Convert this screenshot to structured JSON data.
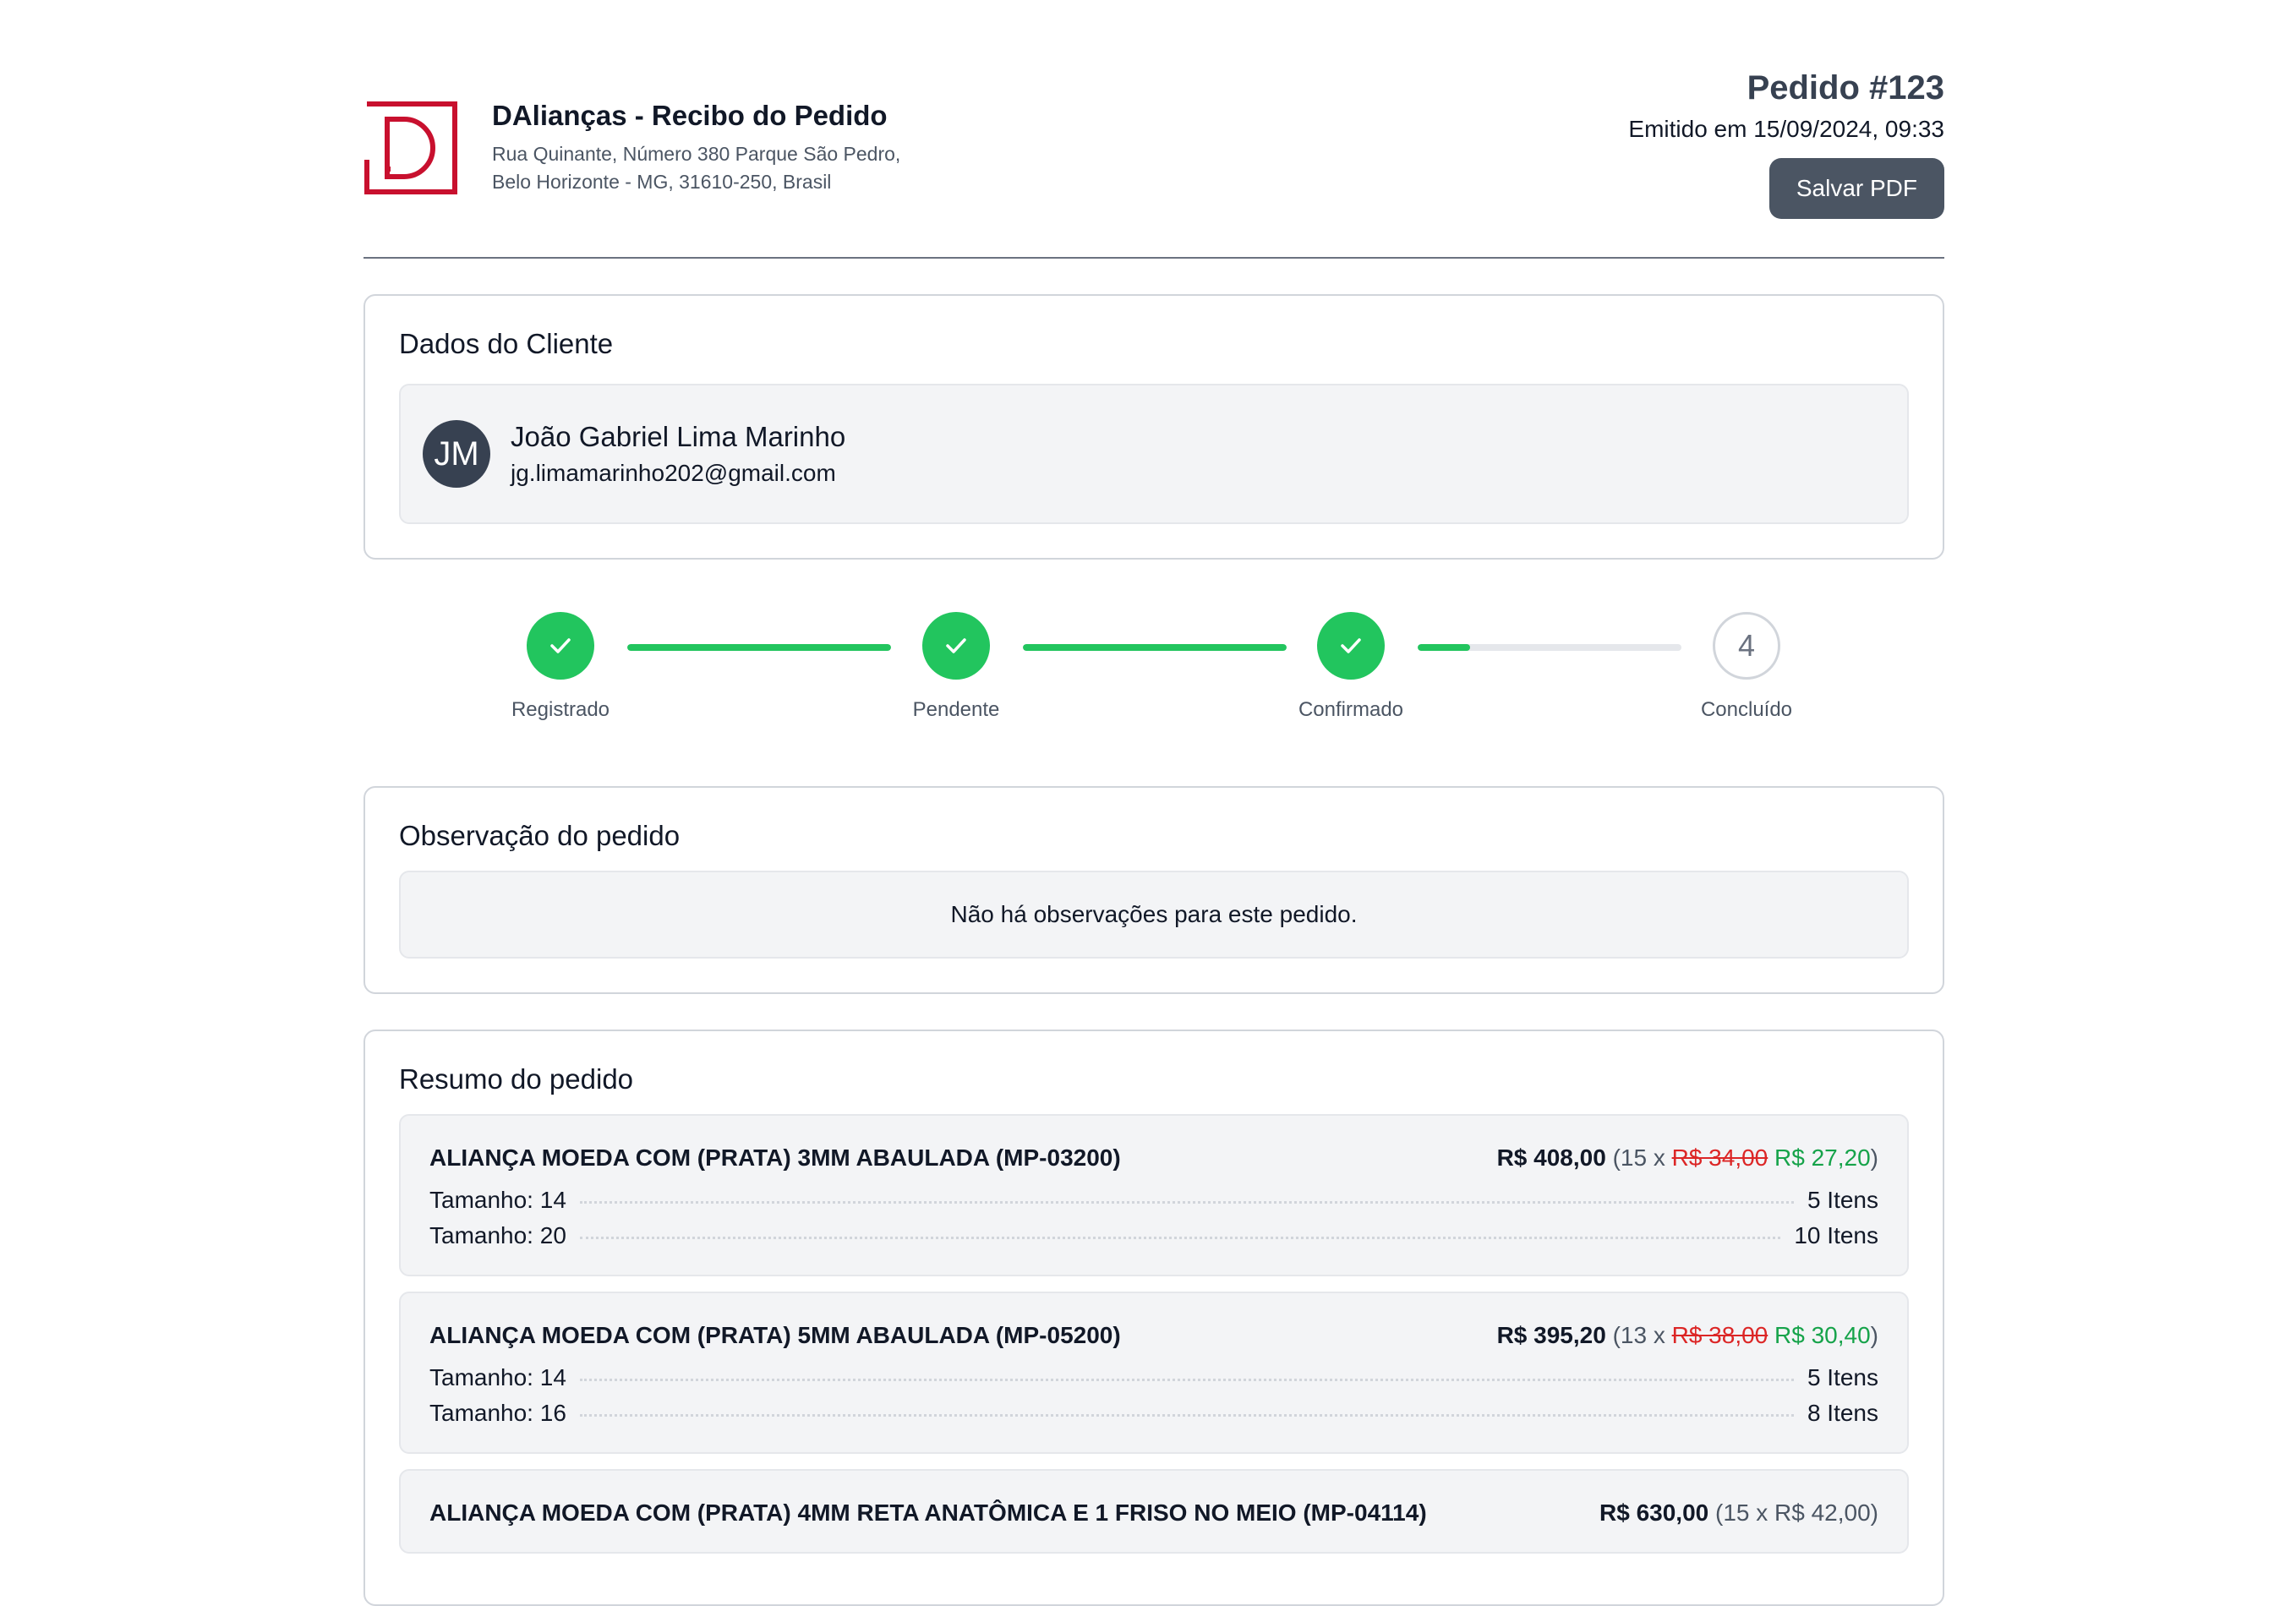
{
  "header": {
    "brand_title": "DAlianças - Recibo do Pedido",
    "address_line1": "Rua Quinante, Número 380 Parque São Pedro,",
    "address_line2": "Belo Horizonte - MG, 31610-250, Brasil",
    "order_number": "Pedido #123",
    "issued": "Emitido em 15/09/2024, 09:33",
    "save_pdf_label": "Salvar PDF",
    "logo_icon": "d-logo-icon",
    "brand_color": "#c8102e"
  },
  "client": {
    "title": "Dados do Cliente",
    "initials": "JM",
    "name": "João Gabriel Lima Marinho",
    "email": "jg.limamarinho202@gmail.com"
  },
  "progress": {
    "steps": [
      {
        "label": "Registrado",
        "status": "done",
        "icon": "check-icon"
      },
      {
        "label": "Pendente",
        "status": "done",
        "icon": "check-icon"
      },
      {
        "label": "Confirmado",
        "status": "done",
        "icon": "check-icon"
      },
      {
        "label": "Concluído",
        "status": "todo",
        "number": "4"
      }
    ],
    "bar_fill_percent": [
      100,
      100,
      20
    ],
    "accent_color": "#22c55e"
  },
  "observation": {
    "title": "Observação do pedido",
    "text": "Não há observações para este pedido."
  },
  "summary": {
    "title": "Resumo do pedido",
    "items": [
      {
        "name": "ALIANÇA MOEDA COM (PRATA) 3MM ABAULADA (MP-03200)",
        "total": "R$ 408,00",
        "qty_prefix": "(15 x ",
        "old_price": "R$ 34,00",
        "new_price": "R$ 27,20",
        "suffix": ")",
        "sizes": [
          {
            "label": "Tamanho: 14",
            "qty": "5 Itens"
          },
          {
            "label": "Tamanho: 20",
            "qty": "10 Itens"
          }
        ]
      },
      {
        "name": "ALIANÇA MOEDA COM (PRATA) 5MM ABAULADA (MP-05200)",
        "total": "R$ 395,20",
        "qty_prefix": "(13 x ",
        "old_price": "R$ 38,00",
        "new_price": "R$ 30,40",
        "suffix": ")",
        "sizes": [
          {
            "label": "Tamanho: 14",
            "qty": "5 Itens"
          },
          {
            "label": "Tamanho: 16",
            "qty": "8 Itens"
          }
        ]
      },
      {
        "name": "ALIANÇA MOEDA COM (PRATA) 4MM RETA ANATÔMICA E 1 FRISO NO MEIO (MP-04114)",
        "total": "R$ 630,00",
        "qty_text": "(15 x R$ 42,00)"
      }
    ]
  }
}
